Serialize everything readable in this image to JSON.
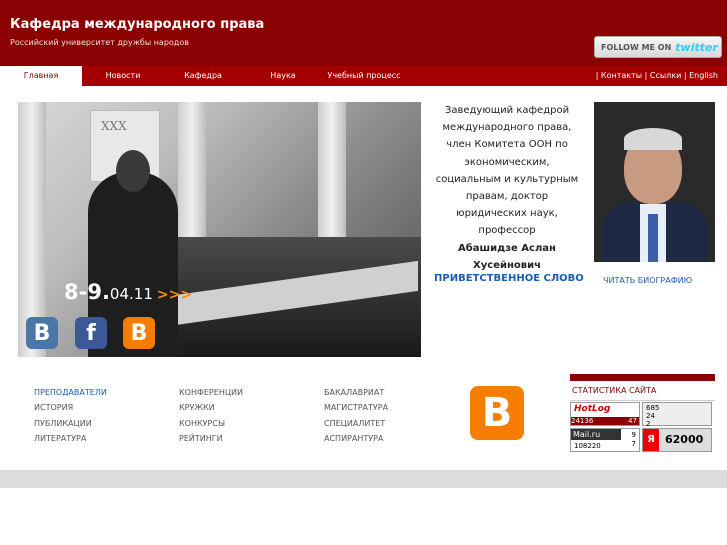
{
  "header": {
    "title": "Кафедра международного права",
    "subtitle": "Российский университет дружбы народов",
    "twitter_prefix": "FOLLOW ME ON",
    "twitter_word": "twitter"
  },
  "nav": {
    "items": [
      "Главная",
      "Новости",
      "Кафедра",
      "Наука",
      "Учебный процесс"
    ],
    "right": "| Контакты | Ссылки | English"
  },
  "banner": {
    "sign_text": "XXX",
    "date_big": "8-9.",
    "date_small": "04.11",
    "arrows": ">>>",
    "social": [
      "vk-icon",
      "facebook-icon",
      "blogger-icon"
    ]
  },
  "bio": {
    "text": "Заведующий кафедрой международного права, член Комитета ООН по экономическим, социальным и культурным правам, доктор юридических наук, профессор",
    "name": "Абашидзе Аслан Хусейнович",
    "welcome_link": "ПРИВЕТСТВЕННОЕ СЛОВО",
    "biography_link": "ЧИТАТЬ БИОГРАФИЮ"
  },
  "links": {
    "col1": [
      "ПРЕПОДАВАТЕЛИ",
      "ИСТОРИЯ",
      "ПУБЛИКАЦИИ",
      "ЛИТЕРАТУРА"
    ],
    "col2": [
      "КОНФЕРЕНЦИИ",
      "КРУЖКИ",
      "КОНКУРСЫ",
      "РЕЙТИНГИ"
    ],
    "col3": [
      "БАКАЛАВРИАТ",
      "МАГИСТРАТУРА",
      "СПЕЦИАЛИТЕТ",
      "АСПИРАНТУРА"
    ]
  },
  "stats": {
    "title": "СТАТИСТИКА САЙТА",
    "hotlog": {
      "label": "HotLog",
      "value": "24136",
      "extra": "47"
    },
    "counter2": {
      "a": "685",
      "b": "24",
      "c": "2"
    },
    "mailru": {
      "label": "Mail.ru",
      "value": "108220",
      "a": "9",
      "b": "7"
    },
    "yandex": {
      "label": "Я",
      "value": "62000"
    }
  },
  "colors": {
    "brand": "#8b0000",
    "nav": "#a40000",
    "link": "#1a5fb4",
    "accent": "#ff8c00"
  }
}
